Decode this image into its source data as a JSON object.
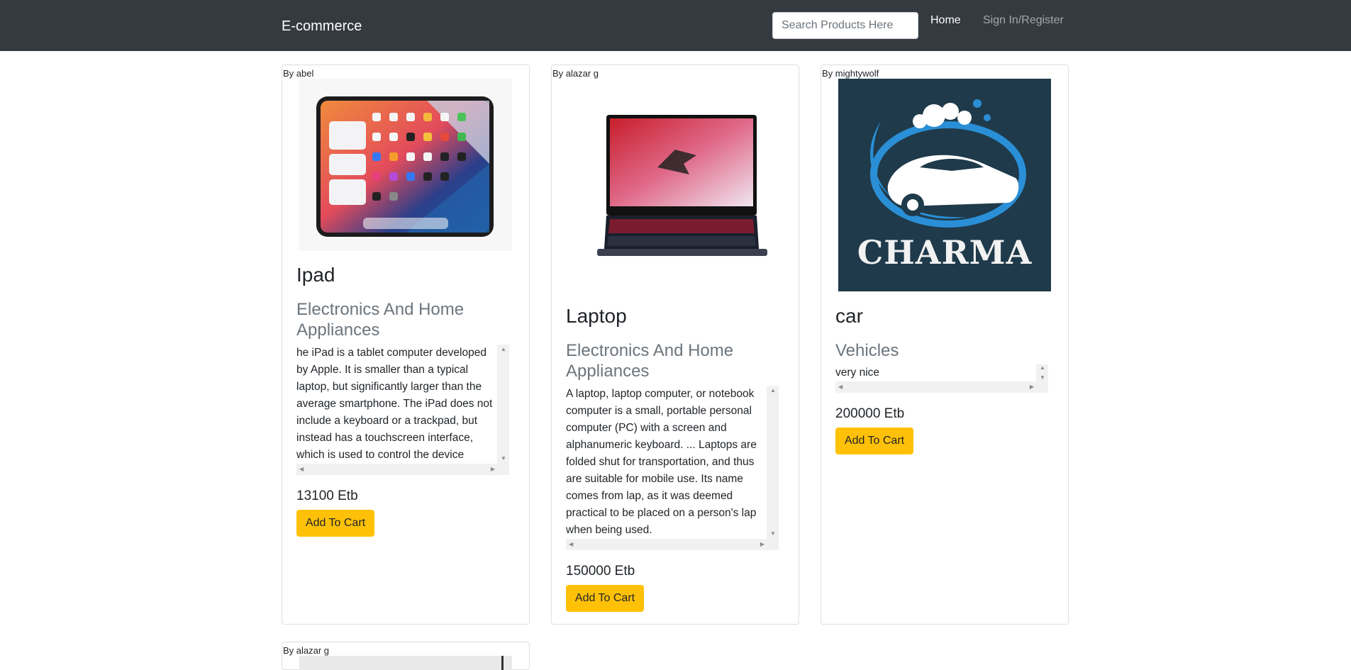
{
  "nav": {
    "brand": "E-commerce",
    "search_placeholder": "Search Products Here",
    "home_label": "Home",
    "signin_label": "Sign In/Register"
  },
  "products": [
    {
      "author": "By abel",
      "title": "Ipad",
      "category": "Electronics And Home Appliances",
      "description": "he iPad is a tablet computer developed by Apple. It is smaller than a typical laptop, but significantly larger than the average smartphone. The iPad does not include a keyboard or a trackpad, but instead has a touchscreen interface, which is used to control the device",
      "price": "13100 Etb",
      "button": "Add To Cart",
      "image": "ipad-image"
    },
    {
      "author": "By alazar g",
      "title": "Laptop",
      "category": "Electronics And Home Appliances",
      "description": "A laptop, laptop computer, or notebook computer is a small, portable personal computer (PC) with a screen and alphanumeric keyboard. ... Laptops are folded shut for transportation, and thus are suitable for mobile use. Its name comes from lap, as it was deemed practical to be placed on a person's lap when being used.",
      "price": "150000 Etb",
      "button": "Add To Cart",
      "image": "laptop-image"
    },
    {
      "author": "By mightywolf",
      "title": "car",
      "category": "Vehicles",
      "description": "very nice",
      "price": "200000 Etb",
      "button": "Add To Cart",
      "image": "charma-logo-image",
      "logo_text": "CHARMA"
    },
    {
      "author": "By alazar g"
    }
  ],
  "colors": {
    "navbar": "#343a40",
    "button": "#ffc107",
    "muted": "#6c757d"
  }
}
